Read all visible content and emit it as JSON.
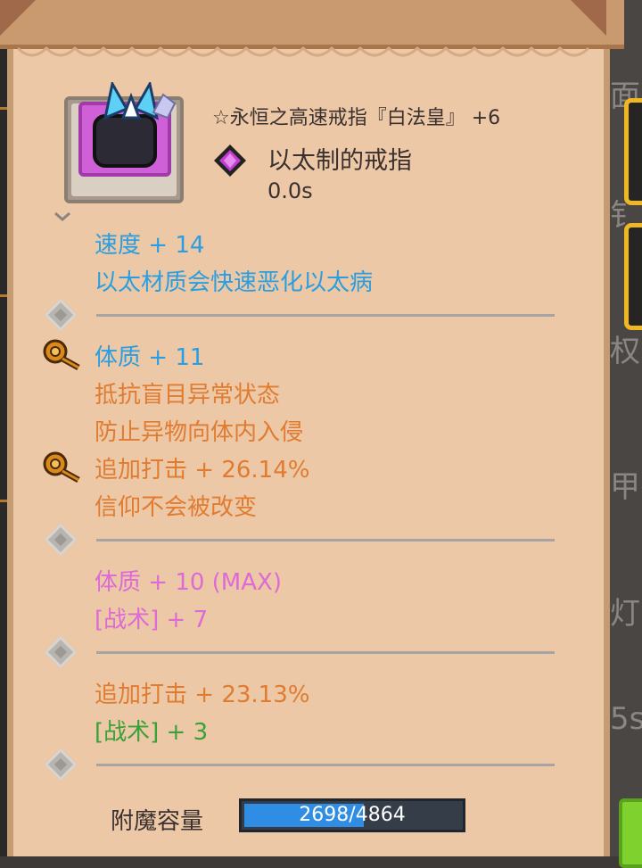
{
  "item": {
    "title": "☆永恒之高速戒指『白法皇』 +6",
    "type_name": "以太制的戒指",
    "cooldown": "0.0s"
  },
  "stats": {
    "speed": "速度 + 14",
    "ether_note": "以太材质会快速恶化以太病",
    "constitution": "体质 + 11",
    "blind_resist": "抵抗盲目异常状态",
    "foreign_block": "防止异物向体内入侵",
    "extra_strike": "追加打击 + 26.14%",
    "faith": "信仰不会被改变",
    "constitution_max": "体质 + 10 (MAX)",
    "tactics_7": "[战术] + 7",
    "extra_strike_2": "追加打击 + 23.13%",
    "tactics_3": "[战术] + 3"
  },
  "enchant": {
    "label": "附魔容量",
    "value_text": "2698/4864",
    "current": 2698,
    "max": 4864
  },
  "background": {
    "chars": [
      "面",
      "钅",
      "权",
      "甲",
      "灯",
      "5s"
    ]
  },
  "colors": {
    "blue": "#2a9ee0",
    "orange": "#e07b30",
    "pink": "#dd6ad6",
    "green": "#3aa038",
    "panel": "#ecc8a6"
  },
  "icons": {
    "ring": "ring-icon",
    "gem": "amethyst-gem-icon",
    "key": "key-icon",
    "socket": "socket-diamond-icon"
  }
}
